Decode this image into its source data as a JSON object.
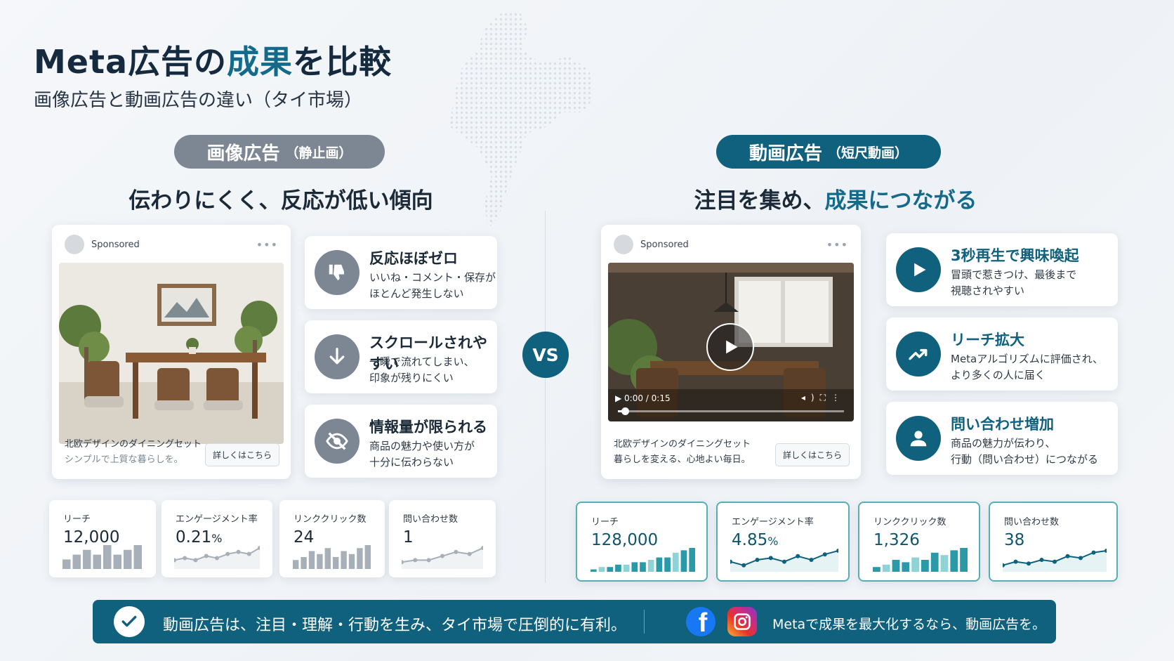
{
  "header": {
    "title_a": "Meta広告の",
    "title_hl": "成果",
    "title_b": "を比較",
    "subtitle": "画像広告と動画広告の違い（タイ市場）"
  },
  "image_side": {
    "pill_main": "画像広告",
    "pill_sub": "（静止画）",
    "headline": "伝わりにくく、反応が低い傾向",
    "ad": {
      "sponsored": "Sponsored",
      "menu": "•••",
      "caption_title": "北欧デザインのダイニングセット",
      "caption_sub": "シンプルで上質な暮らしを。",
      "cta": "詳しくはこちら"
    },
    "features": [
      {
        "icon": "thumbs-down-icon",
        "title": "反応ほぼゼロ",
        "desc": "いいね・コメント・保存が\nほとんど発生しない"
      },
      {
        "icon": "arrow-down-icon",
        "title": "スクロールされやすい",
        "desc": "一瞬で流れてしまい、\n印象が残りにくい"
      },
      {
        "icon": "eye-slash-icon",
        "title": "情報量が限られる",
        "desc": "商品の魅力や使い方が\n十分に伝わらない"
      }
    ],
    "metrics": [
      {
        "label": "リーチ",
        "value": "12,000",
        "chart": "bar",
        "points": [
          2,
          3,
          4,
          3,
          5,
          3,
          4,
          5
        ]
      },
      {
        "label": "エンゲージメント率",
        "value": "0.21",
        "unit": "%",
        "chart": "line",
        "points": [
          3,
          4,
          3,
          5,
          4,
          6,
          7,
          6,
          9
        ]
      },
      {
        "label": "リンククリック数",
        "value": "24",
        "chart": "bar",
        "points": [
          3,
          4,
          6,
          5,
          7,
          4,
          6,
          5,
          7,
          8
        ]
      },
      {
        "label": "問い合わせ数",
        "value": "1",
        "chart": "line",
        "points": [
          2,
          3,
          3,
          5,
          7,
          6,
          9
        ]
      }
    ]
  },
  "video_side": {
    "pill_main": "動画広告",
    "pill_sub": "（短尺動画）",
    "headline_a": "注目を集め、",
    "headline_hl": "成果につながる",
    "ad": {
      "sponsored": "Sponsored",
      "menu": "•••",
      "time": "0:00 / 0:15",
      "progress": 0.03,
      "caption_title": "北欧デザインのダイニングセット",
      "caption_sub": "暮らしを変える、心地よい毎日。",
      "cta": "詳しくはこちら"
    },
    "features": [
      {
        "icon": "play-icon",
        "title": "3秒再生で興味喚起",
        "desc": "冒頭で惹きつけ、最後まで\n視聴されやすい"
      },
      {
        "icon": "trend-up-icon",
        "title": "リーチ拡大",
        "desc": "Metaアルゴリズムに評価され、\nより多くの人に届く"
      },
      {
        "icon": "person-icon",
        "title": "問い合わせ増加",
        "desc": "商品の魅力が伝わり、\n行動（問い合わせ）につながる"
      }
    ],
    "metrics": [
      {
        "label": "リーチ",
        "value": "128,000",
        "chart": "bar",
        "points": [
          1,
          2,
          2,
          3,
          3,
          4,
          4,
          5,
          6,
          6,
          8,
          9,
          10
        ]
      },
      {
        "label": "エンゲージメント率",
        "value": "4.85",
        "unit": "%",
        "chart": "line",
        "points": [
          4,
          2,
          5,
          6,
          4,
          7,
          5,
          8,
          10
        ]
      },
      {
        "label": "リンククリック数",
        "value": "1,326",
        "chart": "bar",
        "points": [
          2,
          3,
          5,
          4,
          6,
          5,
          8,
          7,
          9,
          10
        ]
      },
      {
        "label": "問い合わせ数",
        "value": "38",
        "chart": "line",
        "points": [
          2,
          4,
          3,
          5,
          4,
          7,
          6,
          9,
          10
        ]
      }
    ]
  },
  "vs_label": "VS",
  "banner": {
    "main": "動画広告は、注目・理解・行動を生み、タイ市場で圧倒的に有利。",
    "sub": "Metaで成果を最大化するなら、動画広告を。"
  },
  "colors": {
    "teal": "#0f617e",
    "grey": "#7c8793",
    "bar_teal": "#2a9aa8",
    "bar_light": "#8fd3d6",
    "bar_grey": "#a7b0b9"
  }
}
